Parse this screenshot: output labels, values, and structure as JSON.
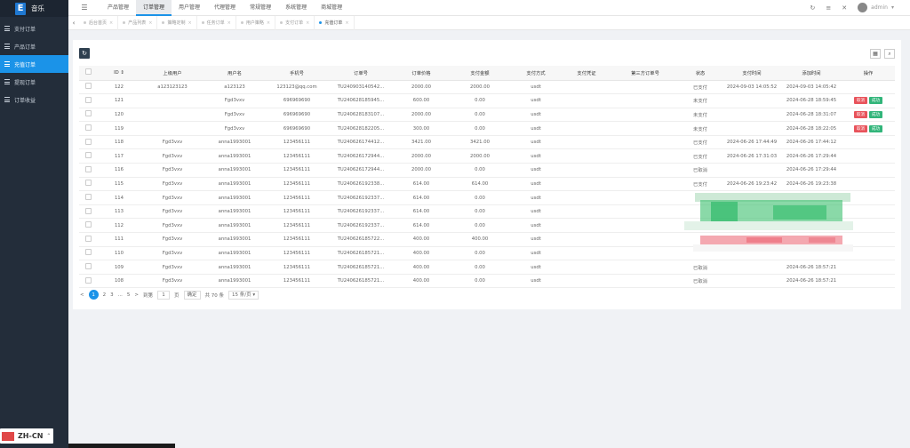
{
  "app": {
    "logo_letter": "E",
    "title": "音乐"
  },
  "sidebar": {
    "items": [
      {
        "label": "支付订单"
      },
      {
        "label": "产品订单"
      },
      {
        "label": "充值订单"
      },
      {
        "label": "提现订单"
      },
      {
        "label": "订单收益"
      }
    ],
    "active_index": 2
  },
  "language": {
    "label": "ZH-CN",
    "caret": "⌃"
  },
  "topnav": {
    "items": [
      "产品管理",
      "订单管理",
      "用户管理",
      "代理管理",
      "常规管理",
      "系统管理",
      "商城管理"
    ],
    "active_index": 1,
    "user": "admin",
    "icons": [
      "refresh-icon",
      "toggle-icon",
      "fullscreen-icon"
    ]
  },
  "tabs": {
    "items": [
      "后台首页",
      "产品列表",
      "策略定制",
      "任务订单",
      "用户策略",
      "支付订单",
      "充值订单"
    ],
    "active_index": 6
  },
  "table": {
    "headers": [
      "",
      "ID ⇕",
      "上级用户",
      "用户名",
      "手机号",
      "订单号",
      "订单价格",
      "支付金额",
      "支付方式",
      "支付凭证",
      "第三方订单号",
      "状态",
      "支付时间",
      "添加时间",
      "操作"
    ],
    "rows": [
      [
        "122",
        "a123123123",
        "a123123",
        "123123@qq.com",
        "TU240903140542...",
        "2000.00",
        "2000.00",
        "usdt",
        "",
        "",
        "已支付",
        "2024-09-03 14:05:52",
        "2024-09-03 14:05:42",
        ""
      ],
      [
        "121",
        "",
        "Fgd3vxv",
        "696969690",
        "TU240628185945...",
        "600.00",
        "0.00",
        "usdt",
        "",
        "",
        "未支付",
        "",
        "2024-06-28 18:59:45",
        "actions"
      ],
      [
        "120",
        "",
        "Fgd3vxv",
        "696969690",
        "TU240628183107...",
        "2000.00",
        "0.00",
        "usdt",
        "",
        "",
        "未支付",
        "",
        "2024-06-28 18:31:07",
        "actions"
      ],
      [
        "119",
        "",
        "Fgd3vxv",
        "696969690",
        "TU240628182205...",
        "300.00",
        "0.00",
        "usdt",
        "",
        "",
        "未支付",
        "",
        "2024-06-28 18:22:05",
        "actions"
      ],
      [
        "118",
        "Fgd3vxv",
        "anna1993001",
        "123456111",
        "TU240626174412...",
        "3421.00",
        "3421.00",
        "usdt",
        "",
        "",
        "已支付",
        "2024-06-26 17:44:49",
        "2024-06-26 17:44:12",
        ""
      ],
      [
        "117",
        "Fgd3vxv",
        "anna1993001",
        "123456111",
        "TU240626172944...",
        "2000.00",
        "2000.00",
        "usdt",
        "",
        "",
        "已支付",
        "2024-06-26 17:31:03",
        "2024-06-26 17:29:44",
        ""
      ],
      [
        "116",
        "Fgd3vxv",
        "anna1993001",
        "123456111",
        "TU240626172944...",
        "2000.00",
        "0.00",
        "usdt",
        "",
        "",
        "已取消",
        "",
        "2024-06-26 17:29:44",
        ""
      ],
      [
        "115",
        "Fgd3vxv",
        "anna1993001",
        "123456111",
        "TU240626192338...",
        "614.00",
        "614.00",
        "usdt",
        "",
        "",
        "已支付",
        "2024-06-26 19:23:42",
        "2024-06-26 19:23:38",
        ""
      ],
      [
        "114",
        "Fgd3vxv",
        "anna1993001",
        "123456111",
        "TU240626192337...",
        "614.00",
        "0.00",
        "usdt",
        "",
        "",
        "",
        "",
        "",
        ""
      ],
      [
        "113",
        "Fgd3vxv",
        "anna1993001",
        "123456111",
        "TU240626192337...",
        "614.00",
        "0.00",
        "usdt",
        "",
        "",
        "",
        "",
        "",
        ""
      ],
      [
        "112",
        "Fgd3vxv",
        "anna1993001",
        "123456111",
        "TU240626192337...",
        "614.00",
        "0.00",
        "usdt",
        "",
        "",
        "",
        "",
        "",
        ""
      ],
      [
        "111",
        "Fgd3vxv",
        "anna1993001",
        "123456111",
        "TU240626185722...",
        "400.00",
        "400.00",
        "usdt",
        "",
        "",
        "",
        "",
        "",
        ""
      ],
      [
        "110",
        "Fgd3vxv",
        "anna1993001",
        "123456111",
        "TU240626185721...",
        "400.00",
        "0.00",
        "usdt",
        "",
        "",
        "",
        "",
        "",
        ""
      ],
      [
        "109",
        "Fgd3vxv",
        "anna1993001",
        "123456111",
        "TU240626185721...",
        "400.00",
        "0.00",
        "usdt",
        "",
        "",
        "已取消",
        "",
        "2024-06-26 18:57:21",
        ""
      ],
      [
        "108",
        "Fgd3vxv",
        "anna1993001",
        "123456111",
        "TU240626185721...",
        "400.00",
        "0.00",
        "usdt",
        "",
        "",
        "已取消",
        "",
        "2024-06-26 18:57:21",
        ""
      ]
    ],
    "action_labels": {
      "cancel": "取消",
      "success": "成功"
    }
  },
  "pager": {
    "prev": "<",
    "pages": [
      "1",
      "2",
      "3",
      "...",
      "5"
    ],
    "current": "1",
    "next": ">",
    "goto_label": "到第",
    "goto_value": "1",
    "page_unit": "页",
    "confirm": "确定",
    "total": "共 70 条",
    "per_page": "15 条/页"
  },
  "colors": {
    "accent": "#1b93e8",
    "sidebar_bg": "#232d3a",
    "danger": "#e8535b",
    "success": "#32b57a"
  }
}
